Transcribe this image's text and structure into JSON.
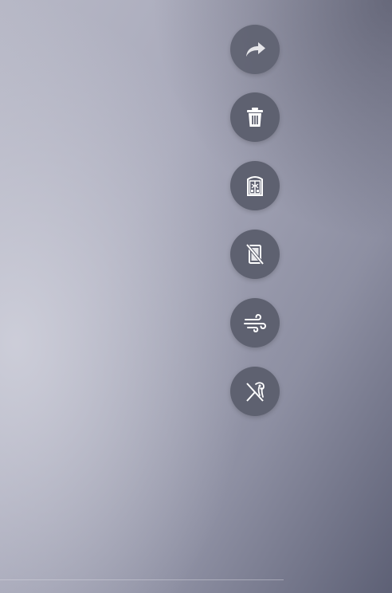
{
  "screen": {
    "background_colors": [
      "#b7b8c6",
      "#a9aabb",
      "#8d8fa2",
      "#5d6075"
    ],
    "button_color": "#5e6170",
    "icon_color": "#ffffff"
  },
  "actions": [
    {
      "id": "share",
      "icon": "share-arrow-icon"
    },
    {
      "id": "delete",
      "icon": "trash-icon"
    },
    {
      "id": "wardrobe",
      "icon": "wardrobe-icon"
    },
    {
      "id": "no-phone",
      "icon": "no-phone-icon"
    },
    {
      "id": "wind",
      "icon": "wind-icon"
    },
    {
      "id": "no-hair",
      "icon": "no-hair-icon"
    }
  ]
}
